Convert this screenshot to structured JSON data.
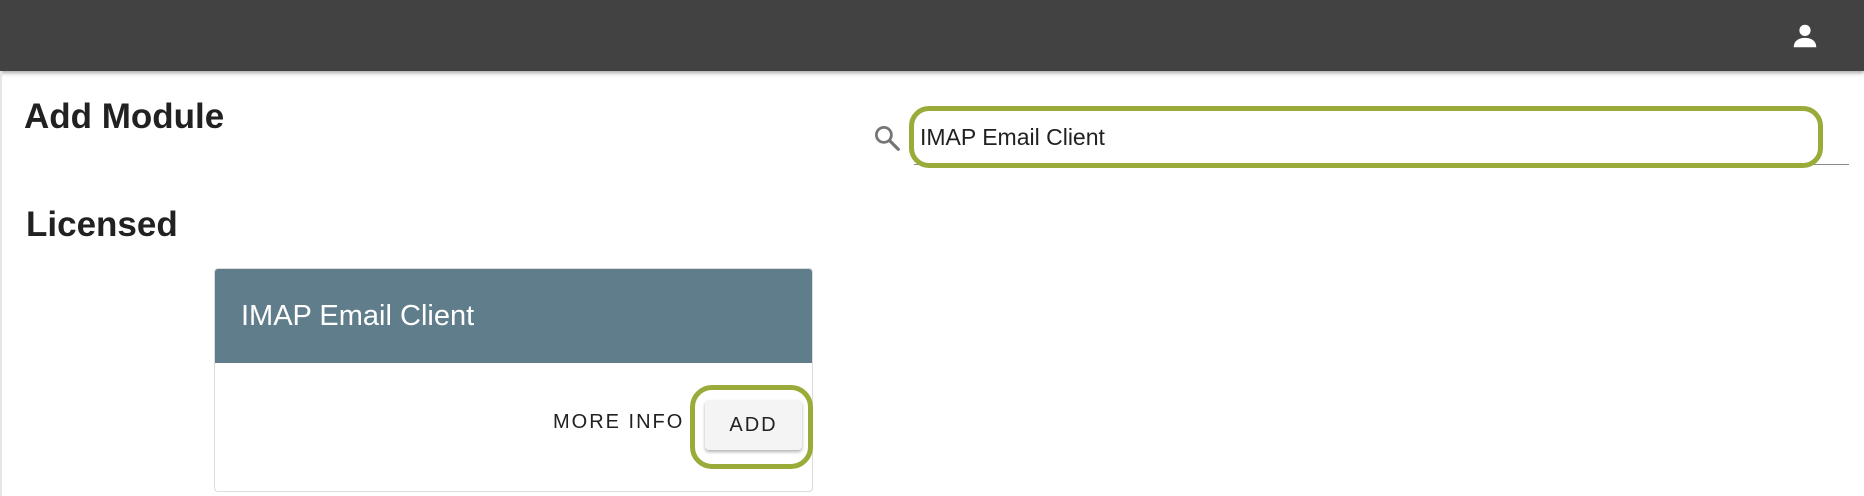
{
  "header": {
    "account_icon": "account-icon"
  },
  "page": {
    "title": "Add Module"
  },
  "search": {
    "icon": "search-icon",
    "value": "IMAP Email Client",
    "highlighted": true
  },
  "sections": [
    {
      "title": "Licensed",
      "cards": [
        {
          "title": "IMAP Email Client",
          "header_color": "#607d8b",
          "more_info_label": "MORE INFO",
          "add_label": "ADD",
          "add_highlighted": true
        }
      ]
    }
  ],
  "colors": {
    "topbar": "#424242",
    "highlight": "#9aab3a",
    "card_header": "#607d8b"
  }
}
